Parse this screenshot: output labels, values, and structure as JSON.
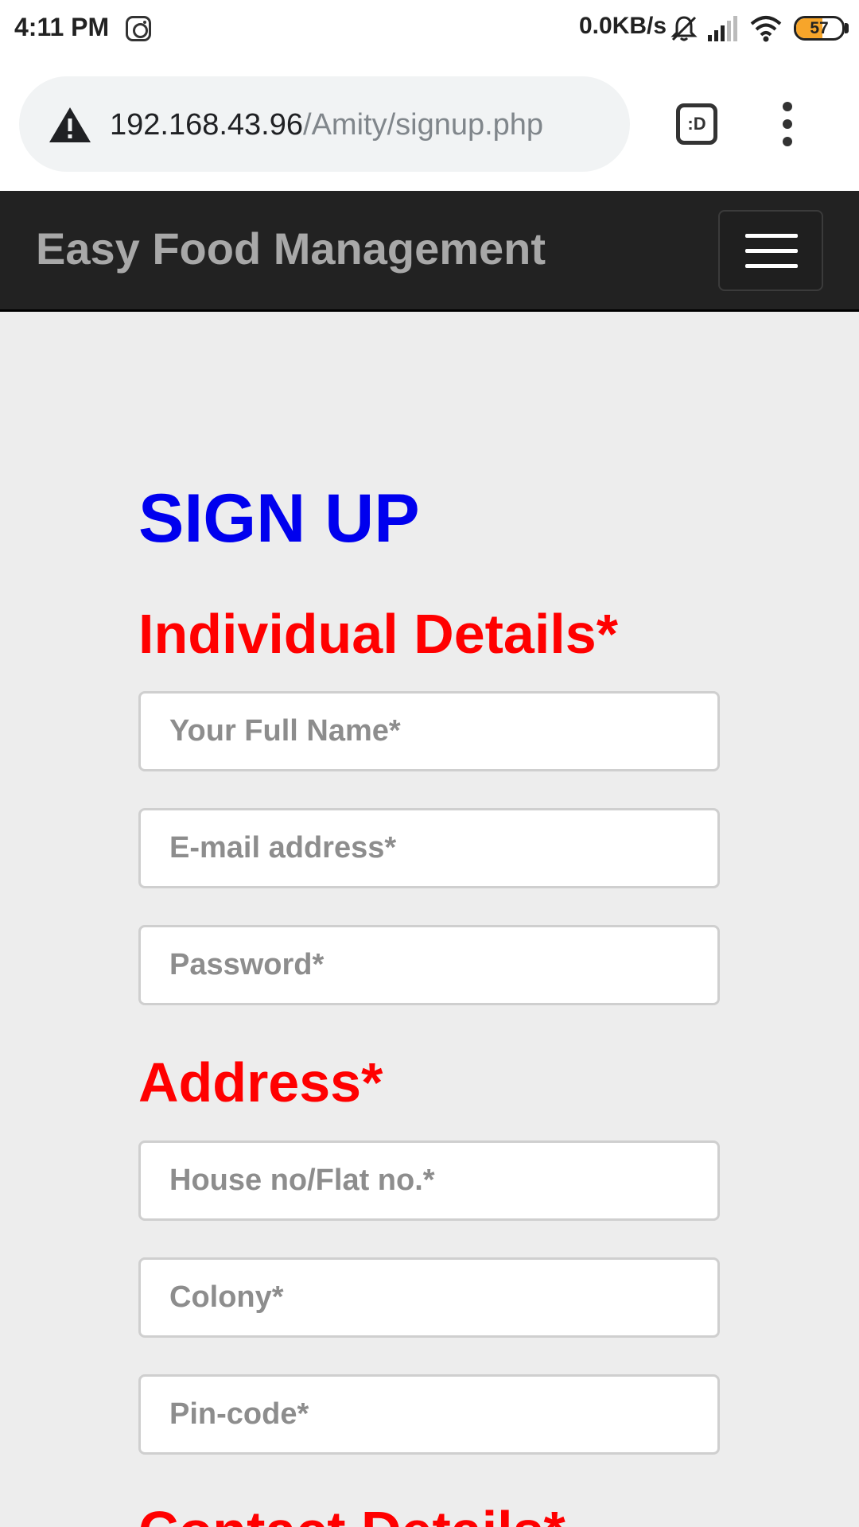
{
  "status_bar": {
    "time": "4:11 PM",
    "net_speed": "0.0KB/s",
    "battery_level": "57",
    "battery_fraction": 0.57,
    "icons": [
      "instagram-icon",
      "bell-muted-icon",
      "signal-icon",
      "wifi-icon",
      "battery-icon"
    ]
  },
  "browser": {
    "url_host": "192.168.43.96",
    "url_path": "/Amity/signup.php",
    "security_icon": "warning-icon",
    "tab_switcher_label": ":D",
    "menu_icon": "more-vert-icon"
  },
  "navbar": {
    "brand": "Easy Food Management",
    "toggler_icon": "hamburger-icon"
  },
  "form": {
    "title": "SIGN UP",
    "sections": {
      "individual": {
        "title": "Individual Details*",
        "full_name_placeholder": "Your Full Name*",
        "email_placeholder": "E-mail address*",
        "password_placeholder": "Password*"
      },
      "address": {
        "title": "Address*",
        "house_placeholder": "House no/Flat no.*",
        "colony_placeholder": "Colony*",
        "pincode_placeholder": "Pin-code*"
      },
      "contact": {
        "title": "Contact Details*"
      }
    }
  },
  "colors": {
    "navbar_bg": "#222222",
    "brand_text": "#a8a8a8",
    "title_blue": "#0000ee",
    "section_red": "#ff0000",
    "page_bg": "#ededed",
    "battery_fill": "#f7a52a"
  }
}
